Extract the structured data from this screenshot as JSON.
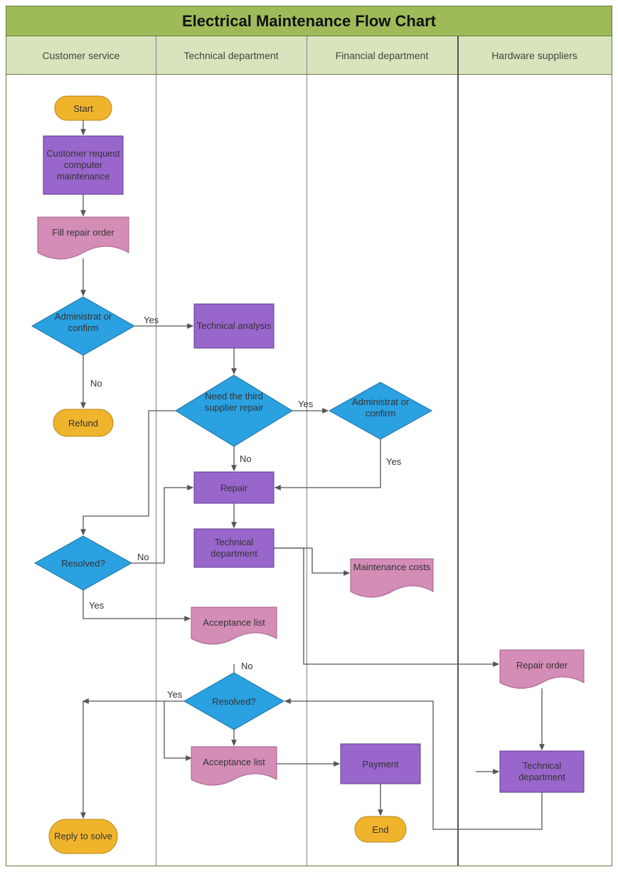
{
  "title": "Electrical Maintenance Flow Chart",
  "lanes": {
    "customer_service": "Customer service",
    "technical_department": "Technical department",
    "financial_department": "Financial department",
    "hardware_suppliers": "Hardware suppliers"
  },
  "nodes": {
    "start": "Start",
    "customer_request": "Customer request computer maintenance",
    "fill_repair_order": "Fill repair order",
    "admin_confirm_cs": "Administrat or confirm",
    "refund": "Refund",
    "technical_analysis": "Technical analysis",
    "need_third_party": "Need the third supplier repair",
    "admin_confirm_fin": "Administrat or confirm",
    "repair": "Repair",
    "tech_dept_1": "Technical department",
    "maintenance_costs": "Maintenance costs",
    "resolved_cs": "Resolved?",
    "acceptance_list_1": "Acceptance list",
    "resolved_td": "Resolved?",
    "acceptance_list_2": "Acceptance list",
    "payment": "Payment",
    "end": "End",
    "repair_order_hw": "Repair order",
    "tech_dept_hw": "Technical department",
    "reply_to_solve": "Reply to solve"
  },
  "edges": {
    "yes": "Yes",
    "no": "No"
  }
}
